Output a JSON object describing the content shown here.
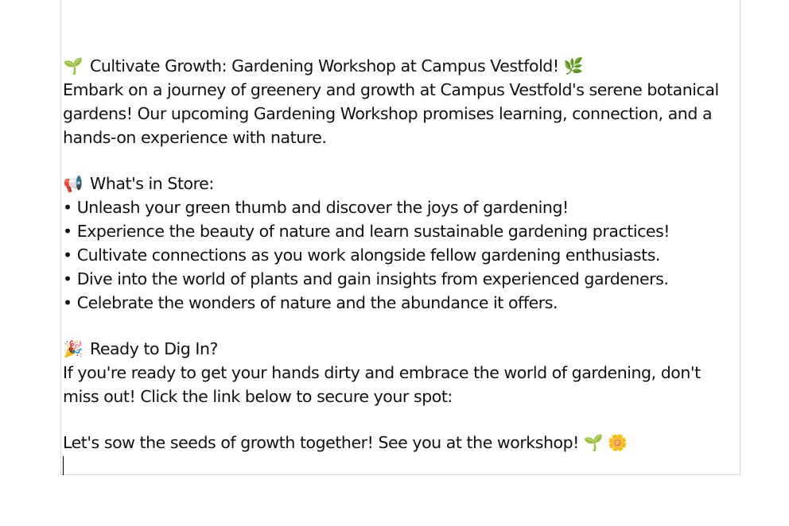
{
  "post": {
    "title_icon": "🌱",
    "title": "Cultivate Growth: Gardening Workshop at Campus Vestfold!",
    "title_trailing_icon": "🌿",
    "intro": "Embark on a journey of greenery and growth at Campus Vestfold's serene botanical gardens! Our upcoming Gardening Workshop promises learning, connection, and a hands-on experience with nature.",
    "section1_icon": "📢",
    "section1_heading": "What's in Store:",
    "bullets": [
      "• Unleash your green thumb and discover the joys of gardening!",
      "• Experience the beauty of nature and learn sustainable gardening practices!",
      "• Cultivate connections as you work alongside fellow gardening enthusiasts.",
      "• Dive into the world of plants and gain insights from experienced gardeners.",
      "• Celebrate the wonders of nature and the abundance it offers."
    ],
    "section2_icon": "🎉",
    "section2_heading": "Ready to Dig In?",
    "cta_text": "If you're ready to get your hands dirty and embrace the world of gardening, don't miss out! Click the link below to secure your spot:",
    "closing": "Let's sow the seeds of growth together! See you at the workshop!",
    "closing_icons": "🌱 🌼"
  }
}
